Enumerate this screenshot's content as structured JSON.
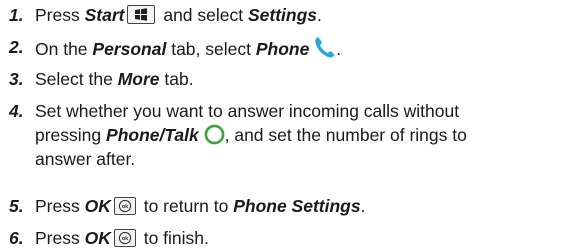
{
  "steps": [
    {
      "number": "1.",
      "parts": {
        "a": "Press ",
        "b": "Start",
        "c": " and select ",
        "d": "Settings",
        "e": "."
      },
      "icons": [
        "windows-start-key-icon"
      ]
    },
    {
      "number": "2.",
      "parts": {
        "a": "On the ",
        "b": "Personal",
        "c": " tab, select ",
        "d": "Phone",
        "e": "."
      },
      "icons": [
        "phone-handset-icon"
      ]
    },
    {
      "number": "3.",
      "parts": {
        "a": "Select the ",
        "b": "More",
        "c": " tab."
      }
    },
    {
      "number": "4.",
      "lines": {
        "l1": "Set whether you want to answer incoming calls without",
        "l2a": "pressing ",
        "l2b": "Phone/Talk",
        "l2c": ", and set the number of rings to",
        "l3": "answer after."
      },
      "icons": [
        "phone-talk-circle-icon"
      ],
      "colors": {
        "phone_talk_ring": "#3aa33a"
      }
    },
    {
      "number": "5.",
      "parts": {
        "a": "Press ",
        "b": "OK",
        "c": " to return to ",
        "d": "Phone Settings",
        "e": "."
      },
      "icons": [
        "ok-key-icon"
      ]
    },
    {
      "number": "6.",
      "parts": {
        "a": "Press ",
        "b": "OK",
        "c": " to finish."
      },
      "icons": [
        "ok-key-icon"
      ]
    }
  ],
  "colors": {
    "text": "#1a1a1a",
    "phone_icon": "#2aa6dd",
    "talk_ring": "#3aa33a"
  }
}
